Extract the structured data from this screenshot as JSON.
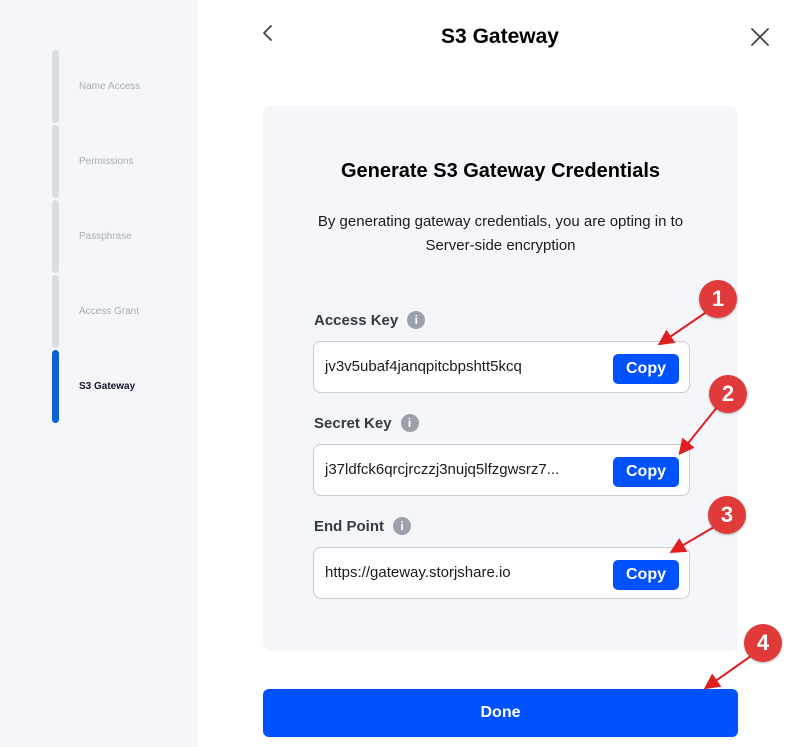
{
  "sidebar": {
    "steps": [
      {
        "label": "Name Access",
        "state": "inactive"
      },
      {
        "label": "Permissions",
        "state": "inactive"
      },
      {
        "label": "Passphrase",
        "state": "inactive"
      },
      {
        "label": "Access Grant",
        "state": "inactive"
      },
      {
        "label": "S3 Gateway",
        "state": "active"
      }
    ]
  },
  "header": {
    "title": "S3 Gateway",
    "back_icon": "chevron-left-icon",
    "close_icon": "close-icon"
  },
  "card": {
    "title": "Generate S3 Gateway Credentials",
    "description": "By generating gateway credentials, you are opting in to Server-side encryption",
    "fields": [
      {
        "label": "Access Key",
        "value": "jv3v5ubaf4janqpitcbpshtt5kcq",
        "copy_label": "Copy"
      },
      {
        "label": "Secret Key",
        "value": "j37ldfck6qrcjrczzj3nujq5lfzgwsrz7...",
        "copy_label": "Copy"
      },
      {
        "label": "End Point",
        "value": "https://gateway.storjshare.io",
        "copy_label": "Copy"
      }
    ],
    "info_icon_glyph": "i"
  },
  "done_label": "Done",
  "annotations": [
    {
      "number": "1"
    },
    {
      "number": "2"
    },
    {
      "number": "3"
    },
    {
      "number": "4"
    }
  ],
  "colors": {
    "primary": "#0052ff",
    "active_step": "#0b63d6",
    "annotation": "#e03a3a"
  }
}
